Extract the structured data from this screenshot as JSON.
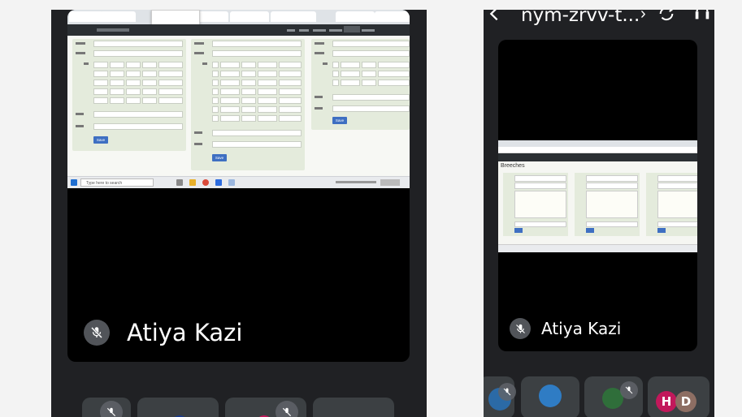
{
  "left": {
    "participant": {
      "name": "Atiya Kazi",
      "mic": "mic-off-icon"
    },
    "shared": {
      "tabs": [
        "...",
        "...",
        "..."
      ],
      "popup_lines": [
        "...",
        "...",
        "..."
      ],
      "taskbar_search": "Type here to search",
      "save_label": "Save"
    }
  },
  "right": {
    "top_bar": {
      "meeting_code": "nym-zrvv-t...",
      "chevron": "›"
    },
    "participant": {
      "name": "Atiya Kazi",
      "mic": "mic-off-icon"
    },
    "thumb_title": "Breeches",
    "avatars": [
      {
        "letter": "H",
        "color": "#c2185b"
      },
      {
        "letter": "D",
        "color": "#8d6e63"
      }
    ]
  },
  "colors": {
    "app_background": "#202124",
    "tile_background": "#000000",
    "chip_background": "#3c4043",
    "badge": "#5f6368"
  }
}
